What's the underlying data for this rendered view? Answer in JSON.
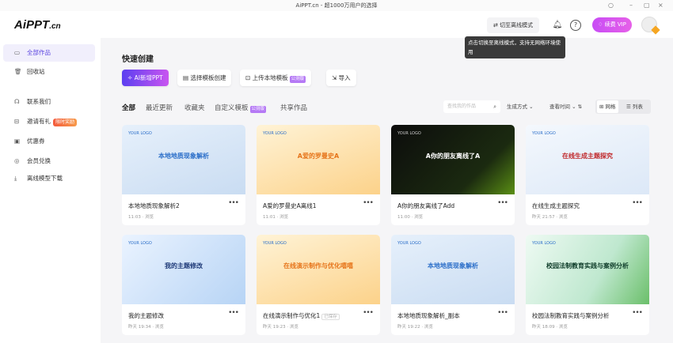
{
  "window": {
    "title": "AiPPT.cn - 超1000万用户的选择",
    "controls": [
      "○",
      "–",
      "▢",
      "×"
    ]
  },
  "header": {
    "logo": "AiPPT",
    "logo_suffix": ".cn",
    "switch_label": "切至离线模式",
    "vip_label": "续费 VIP",
    "tooltip": "点击切换至离线模式，支持无网络环境使用"
  },
  "sidebar": {
    "items": [
      {
        "label": "全部作品",
        "icon": "folder-icon"
      },
      {
        "label": "回收站",
        "icon": "trash-icon"
      },
      {
        "label": "联系我们",
        "icon": "headset-icon"
      },
      {
        "label": "邀请有礼",
        "icon": "gift-icon",
        "badge": "限时奖励"
      },
      {
        "label": "优惠券",
        "icon": "coupon-icon"
      },
      {
        "label": "会员兑换",
        "icon": "exchange-icon"
      },
      {
        "label": "离线模型下载",
        "icon": "download-icon"
      }
    ]
  },
  "quick_create": {
    "title": "快速创建",
    "buttons": [
      {
        "label": "AI新增PPT"
      },
      {
        "label": "选择模板创建"
      },
      {
        "label": "上传本地模板",
        "tag": "公测版"
      },
      {
        "label": "导入"
      }
    ]
  },
  "tabs": [
    {
      "label": "全部"
    },
    {
      "label": "最近更新"
    },
    {
      "label": "收藏夹"
    },
    {
      "label": "自定义模板",
      "tag": "公测版"
    },
    {
      "label": "共享作品"
    }
  ],
  "toolbar": {
    "search_placeholder": "查找我的作品",
    "filter_generate": "生成方式",
    "sort_label": "查看时间",
    "grid_label": "网格",
    "list_label": "列表"
  },
  "cards": [
    {
      "name": "本地地质现象解析2",
      "meta": "11:03 · 浏览",
      "thumb_title": "本地地质现象解析",
      "theme": "blue"
    },
    {
      "name": "A爱的罗曼史A离线1",
      "meta": "11:01 · 浏览",
      "thumb_title": "A爱的罗曼史A",
      "theme": "orange"
    },
    {
      "name": "A你的朋友离线了Add",
      "meta": "11:00 · 浏览",
      "thumb_title": "A你的朋友离线了A",
      "theme": "dark"
    },
    {
      "name": "在线生成主题探究",
      "meta": "昨天 21:57 · 浏览",
      "thumb_title": "在线生成主题探究",
      "theme": "red"
    },
    {
      "name": "我的主题修改",
      "meta": "昨天 19:34 · 浏览",
      "thumb_title": "我的主题修改",
      "theme": "tech"
    },
    {
      "name": "在线演示制作与优化1",
      "meta": "昨天 19:23 · 浏览",
      "thumb_title": "在线演示制作与优化嘻嘻",
      "theme": "orange",
      "saved": "已保存"
    },
    {
      "name": "本地地质现象解析_副本",
      "meta": "昨天 19:22 · 浏览",
      "thumb_title": "本地地质现象解析",
      "theme": "blue"
    },
    {
      "name": "校园法制教育实践与案例分析",
      "meta": "昨天 18:09 · 浏览",
      "thumb_title": "校园法制教育实践与案例分析",
      "theme": "green"
    }
  ],
  "thumb_logo": "YOUR LOGO"
}
